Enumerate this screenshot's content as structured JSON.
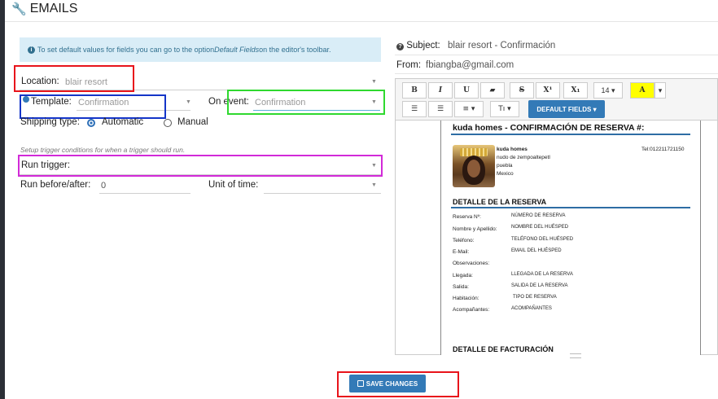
{
  "header": {
    "title": "EMAILS"
  },
  "info": {
    "prefix": "To set default values for fields you can go to the option ",
    "emphasis": "Default Fields",
    "suffix": " on the editor's toolbar."
  },
  "form": {
    "location_label": "Location:",
    "location_value": "blair resort",
    "template_label": "Template:",
    "template_value": "Confirmation",
    "on_event_label": "On event:",
    "on_event_value": "Confirmation",
    "shipping_label": "Shipping type:",
    "automatic_label": "Automatic",
    "manual_label": "Manual",
    "trigger_hint": "Setup trigger conditions for when a trigger should run.",
    "run_trigger_label": "Run trigger:",
    "run_before_label": "Run before/after:",
    "run_before_value": "0",
    "unit_label": "Unit of time:"
  },
  "email": {
    "subject_label": "Subject:",
    "subject_value": "blair resort - Confirmación",
    "from_label": "From:",
    "from_value": "fbiangba@gmail.com"
  },
  "toolbar": {
    "bold": "B",
    "italic": "I",
    "underline": "U",
    "eraser": "▰",
    "strike": "S",
    "superscript": "X¹",
    "subscript": "X₁",
    "font_size": "14 ▾",
    "color": "A",
    "more": "▾",
    "ul": "☰",
    "ol": "☰",
    "align": "≡ ▾",
    "text_style": "Tı ▾",
    "default_fields": "DEFAULT FIELDS ▾"
  },
  "document": {
    "title": "kuda homes - CONFIRMACIÓN DE RESERVA #:",
    "hotel_name": "kuda homes",
    "address1": "nudo de zempoaltepetl",
    "address2": "puebla",
    "address3": "Mexico",
    "phone": "Tel:012211721150",
    "section_title": "DETALLE DE LA RESERVA",
    "rows": [
      {
        "label": "Reserva Nº:",
        "value": "NÚMERO DE RESERVA"
      },
      {
        "label": "Nombre y Apellido:",
        "value": "NOMBRE DEL HUÉSPED"
      },
      {
        "label": "Teléfono:",
        "value": "TELÉFONO DEL HUÉSPED"
      },
      {
        "label": "E-Mail:",
        "value": "EMAIL DEL HUÉSPED"
      },
      {
        "label": "Observaciones:",
        "value": ""
      },
      {
        "label": "Llegada:",
        "value": "LLEGADA DE LA RESERVA"
      },
      {
        "label": "Salida:",
        "value": "SALIDA DE LA RESERVA"
      },
      {
        "label": "Habitación:",
        "value": "TIPO DE RESERVA"
      },
      {
        "label": "Acompañantes:",
        "value": "ACOMPAÑANTES"
      }
    ],
    "billing_title": "DETALLE DE FACTURACIÓN"
  },
  "save": {
    "label": "SAVE CHANGES"
  },
  "colors": {
    "red": "#e8141b",
    "blue": "#1435c8",
    "green": "#2fd92f",
    "magenta": "#d22ad8",
    "primary": "#337ab7"
  }
}
